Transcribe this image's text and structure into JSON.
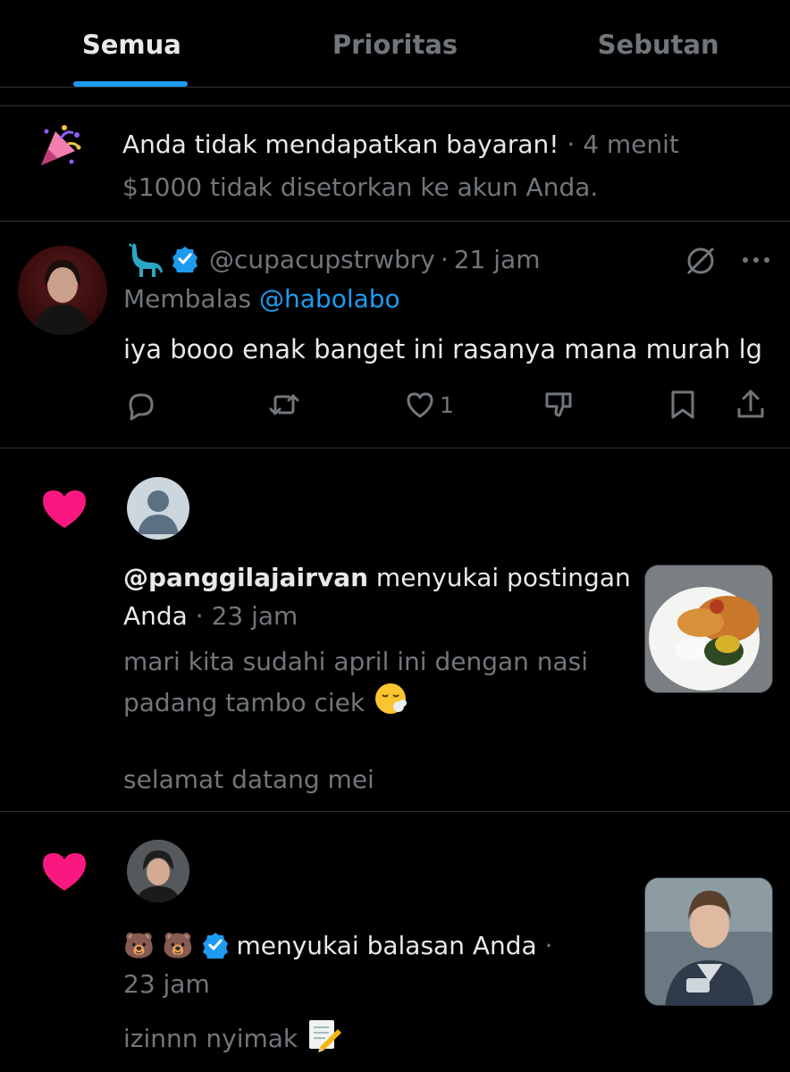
{
  "tabs": [
    {
      "label": "Semua",
      "active": true
    },
    {
      "label": "Prioritas",
      "active": false
    },
    {
      "label": "Sebutan",
      "active": false
    }
  ],
  "payout_notification": {
    "title": "Anda tidak mendapatkan bayaran!",
    "dot": "·",
    "time": "4 menit",
    "body": "$1000 tidak disetorkan ke akun Anda."
  },
  "reply_tweet": {
    "handle": "@cupacupstrwbry",
    "dot": "·",
    "time": "21 jam",
    "replying_prefix": "Membalas",
    "replying_to": "@habolabo",
    "text": "iya booo enak banget ini rasanya mana murah lg",
    "like_count": "1"
  },
  "like_notification_1": {
    "user": "@panggilajairvan",
    "action": " menyukai postingan Anda",
    "dot": "·",
    "time": "23 jam",
    "post_text_1": "mari kita sudahi april ini dengan nasi",
    "post_text_2": "padang tambo ciek",
    "post_text_3": "selamat datang mei"
  },
  "like_notification_2": {
    "emoji_name": "🐻 🐻",
    "action": "menyukai balasan Anda",
    "dot": "·",
    "time": "23 jam",
    "post_text": "izinnn nyimak"
  },
  "colors": {
    "accent": "#1d9bf0",
    "heart": "#f91880",
    "muted": "#71767b",
    "text": "#e7e9ea"
  }
}
